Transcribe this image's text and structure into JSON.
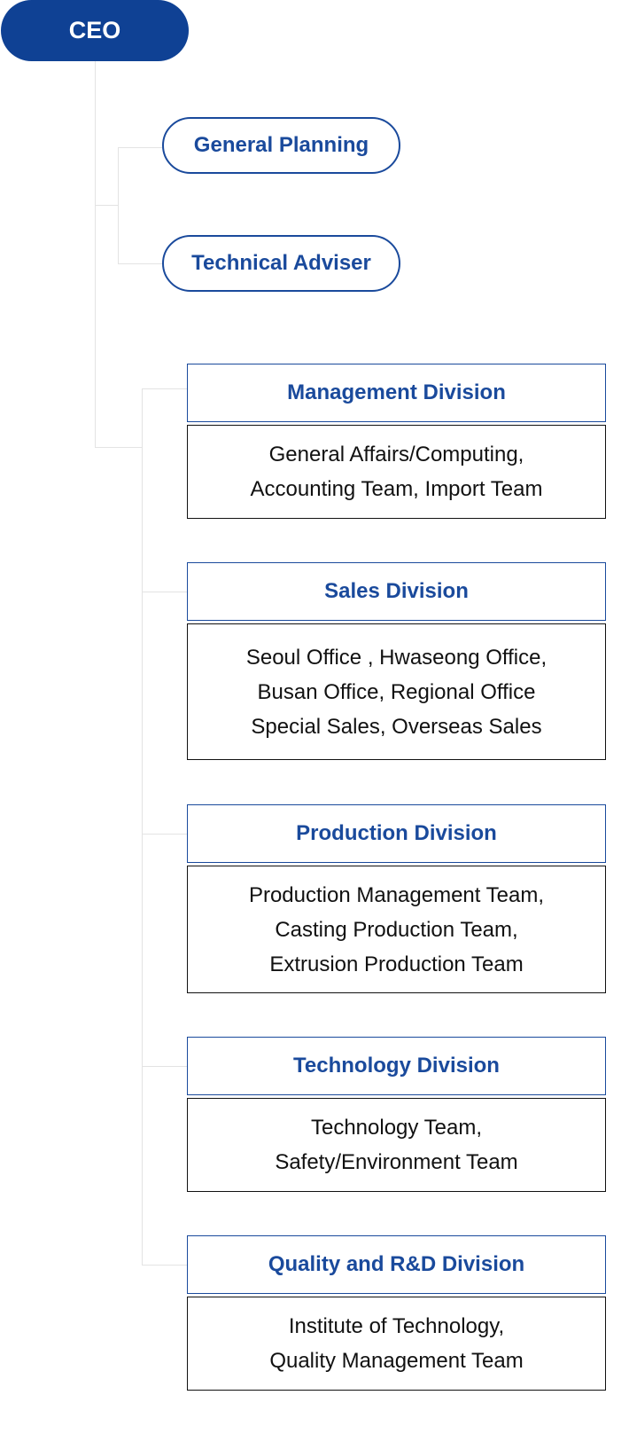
{
  "ceo": {
    "label": "CEO"
  },
  "staff": [
    {
      "label": "General Planning"
    },
    {
      "label": "Technical Adviser"
    }
  ],
  "divisions": [
    {
      "title": "Management Division",
      "teams": [
        "General Affairs/Computing,",
        "Accounting Team, Import Team"
      ]
    },
    {
      "title": "Sales Division",
      "teams": [
        "Seoul Office , Hwaseong Office,",
        "Busan Office, Regional Office",
        "Special Sales, Overseas Sales"
      ]
    },
    {
      "title": "Production Division",
      "teams": [
        "Production Management Team,",
        "Casting Production Team,",
        "Extrusion Production Team"
      ]
    },
    {
      "title": "Technology Division",
      "teams": [
        "Technology Team,",
        "Safety/Environment Team"
      ]
    },
    {
      "title": "Quality and R&D Division",
      "teams": [
        "Institute of Technology,",
        "Quality Management Team"
      ]
    }
  ],
  "colors": {
    "primary": "#0f4194",
    "accent": "#1a4a9c",
    "connector": "#e3e3e3"
  }
}
